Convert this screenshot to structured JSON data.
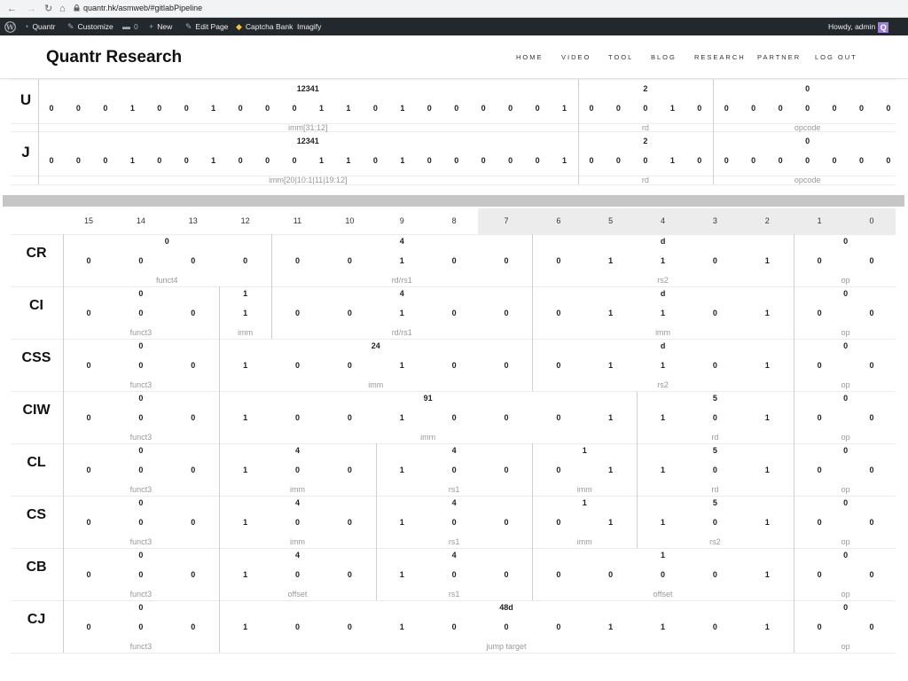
{
  "browser": {
    "back": "←",
    "forward": "→",
    "reload": "↻",
    "home": "⌂",
    "url": "quantr.hk/asmweb/#gitlabPipeline"
  },
  "wpbar": {
    "site": "Quantr",
    "customize": "Customize",
    "comments": "0",
    "new": "New",
    "edit_page": "Edit Page",
    "captcha": "Captcha Bank",
    "imagify": "Imagify",
    "howdy": "Howdy, admin",
    "avatar_letter": "Q"
  },
  "header": {
    "title": "Quantr Research",
    "menu": [
      "HOME",
      "VIDEO",
      "TOOL",
      "BLOG",
      "RESEARCH",
      "PARTNER",
      "LOG OUT"
    ]
  },
  "rv32": [
    {
      "name": "U",
      "bits": [
        "0",
        "0",
        "0",
        "1",
        "0",
        "0",
        "1",
        "0",
        "0",
        "0",
        "1",
        "1",
        "0",
        "1",
        "0",
        "0",
        "0",
        "0",
        "0",
        "1",
        "0",
        "0",
        "0",
        "1",
        "0",
        "0",
        "0",
        "0",
        "0",
        "0",
        "0",
        "0"
      ],
      "fields": [
        {
          "value": "12341",
          "label": "imm[31:12]"
        },
        {
          "value": "2",
          "label": "rd"
        },
        {
          "value": "0",
          "label": "opcode"
        }
      ]
    },
    {
      "name": "J",
      "bits": [
        "0",
        "0",
        "0",
        "1",
        "0",
        "0",
        "1",
        "0",
        "0",
        "0",
        "1",
        "1",
        "0",
        "1",
        "0",
        "0",
        "0",
        "0",
        "0",
        "1",
        "0",
        "0",
        "0",
        "1",
        "0",
        "0",
        "0",
        "0",
        "0",
        "0",
        "0",
        "0"
      ],
      "fields": [
        {
          "value": "12341",
          "label": "imm[20|10:1|11|19:12]"
        },
        {
          "value": "2",
          "label": "rd"
        },
        {
          "value": "0",
          "label": "opcode"
        }
      ]
    }
  ],
  "bit_header": [
    "15",
    "14",
    "13",
    "12",
    "11",
    "10",
    "9",
    "8",
    "7",
    "6",
    "5",
    "4",
    "3",
    "2",
    "1",
    "0"
  ],
  "rvc": [
    {
      "name": "CR",
      "bits": [
        "0",
        "0",
        "0",
        "0",
        "0",
        "0",
        "1",
        "0",
        "0",
        "0",
        "1",
        "1",
        "0",
        "1",
        "0",
        "0"
      ],
      "fields": [
        {
          "value": "0",
          "label": "funct4"
        },
        {
          "value": "4",
          "label": "rd/rs1"
        },
        {
          "value": "d",
          "label": "rs2"
        },
        {
          "value": "0",
          "label": "op"
        }
      ]
    },
    {
      "name": "CI",
      "bits": [
        "0",
        "0",
        "0",
        "1",
        "0",
        "0",
        "1",
        "0",
        "0",
        "0",
        "1",
        "1",
        "0",
        "1",
        "0",
        "0"
      ],
      "fields": [
        {
          "value": "0",
          "label": "funct3"
        },
        {
          "value": "1",
          "label": "imm"
        },
        {
          "value": "4",
          "label": "rd/rs1"
        },
        {
          "value": "d",
          "label": "imm"
        },
        {
          "value": "0",
          "label": "op"
        }
      ]
    },
    {
      "name": "CSS",
      "bits": [
        "0",
        "0",
        "0",
        "1",
        "0",
        "0",
        "1",
        "0",
        "0",
        "0",
        "1",
        "1",
        "0",
        "1",
        "0",
        "0"
      ],
      "fields": [
        {
          "value": "0",
          "label": "funct3"
        },
        {
          "value": "24",
          "label": "imm"
        },
        {
          "value": "d",
          "label": "rs2"
        },
        {
          "value": "0",
          "label": "op"
        }
      ]
    },
    {
      "name": "CIW",
      "bits": [
        "0",
        "0",
        "0",
        "1",
        "0",
        "0",
        "1",
        "0",
        "0",
        "0",
        "1",
        "1",
        "0",
        "1",
        "0",
        "0"
      ],
      "fields": [
        {
          "value": "0",
          "label": "funct3"
        },
        {
          "value": "91",
          "label": "imm"
        },
        {
          "value": "5",
          "label": "rd"
        },
        {
          "value": "0",
          "label": "op"
        }
      ]
    },
    {
      "name": "CL",
      "bits": [
        "0",
        "0",
        "0",
        "1",
        "0",
        "0",
        "1",
        "0",
        "0",
        "0",
        "1",
        "1",
        "0",
        "1",
        "0",
        "0"
      ],
      "fields": [
        {
          "value": "0",
          "label": "funct3"
        },
        {
          "value": "4",
          "label": "imm"
        },
        {
          "value": "4",
          "label": "rs1"
        },
        {
          "value": "1",
          "label": "imm"
        },
        {
          "value": "5",
          "label": "rd"
        },
        {
          "value": "0",
          "label": "op"
        }
      ]
    },
    {
      "name": "CS",
      "bits": [
        "0",
        "0",
        "0",
        "1",
        "0",
        "0",
        "1",
        "0",
        "0",
        "0",
        "1",
        "1",
        "0",
        "1",
        "0",
        "0"
      ],
      "fields": [
        {
          "value": "0",
          "label": "funct3"
        },
        {
          "value": "4",
          "label": "imm"
        },
        {
          "value": "4",
          "label": "rs1"
        },
        {
          "value": "1",
          "label": "imm"
        },
        {
          "value": "5",
          "label": "rs2"
        },
        {
          "value": "0",
          "label": "op"
        }
      ]
    },
    {
      "name": "CB",
      "bits": [
        "0",
        "0",
        "0",
        "1",
        "0",
        "0",
        "1",
        "0",
        "0",
        "0",
        "0",
        "0",
        "0",
        "1",
        "0",
        "0"
      ],
      "fields": [
        {
          "value": "0",
          "label": "funct3"
        },
        {
          "value": "4",
          "label": "offset"
        },
        {
          "value": "4",
          "label": "rs1"
        },
        {
          "value": "1",
          "label": "offset"
        },
        {
          "value": "0",
          "label": "op"
        }
      ]
    },
    {
      "name": "CJ",
      "bits": [
        "0",
        "0",
        "0",
        "1",
        "0",
        "0",
        "1",
        "0",
        "0",
        "0",
        "1",
        "1",
        "0",
        "1",
        "0",
        "0"
      ],
      "fields": [
        {
          "value": "0",
          "label": "funct3"
        },
        {
          "value": "48d",
          "label": "jump target"
        },
        {
          "value": "0",
          "label": "op"
        }
      ]
    }
  ]
}
